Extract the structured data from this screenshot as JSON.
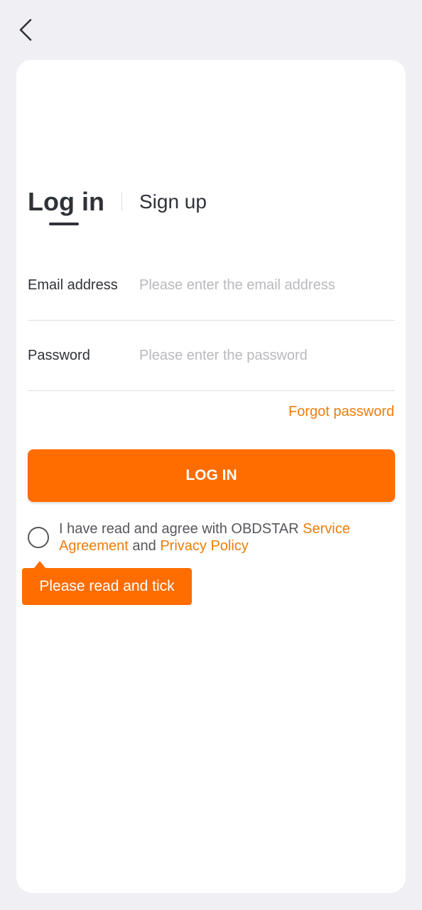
{
  "nav": {
    "back_icon": "chevron-left-icon"
  },
  "tabs": {
    "login_label": "Log in",
    "signup_label": "Sign up"
  },
  "form": {
    "email_label": "Email address",
    "email_placeholder": "Please enter the email address",
    "email_value": "",
    "password_label": "Password",
    "password_placeholder": "Please enter the password",
    "password_value": "",
    "forgot_label": "Forgot password",
    "login_button_label": "LOG IN"
  },
  "agreement": {
    "prefix": "I have read and agree with OBDSTAR ",
    "service_link": "Service Agreement",
    "conjunction": " and ",
    "privacy_link": "Privacy Policy",
    "checked": false
  },
  "tooltip": {
    "text": "Please read and tick"
  },
  "colors": {
    "accent": "#ff6d00",
    "link": "#ee7d0a",
    "background": "#efeff4",
    "card": "#ffffff",
    "text": "#2f3238",
    "placeholder": "#b9b9be"
  }
}
